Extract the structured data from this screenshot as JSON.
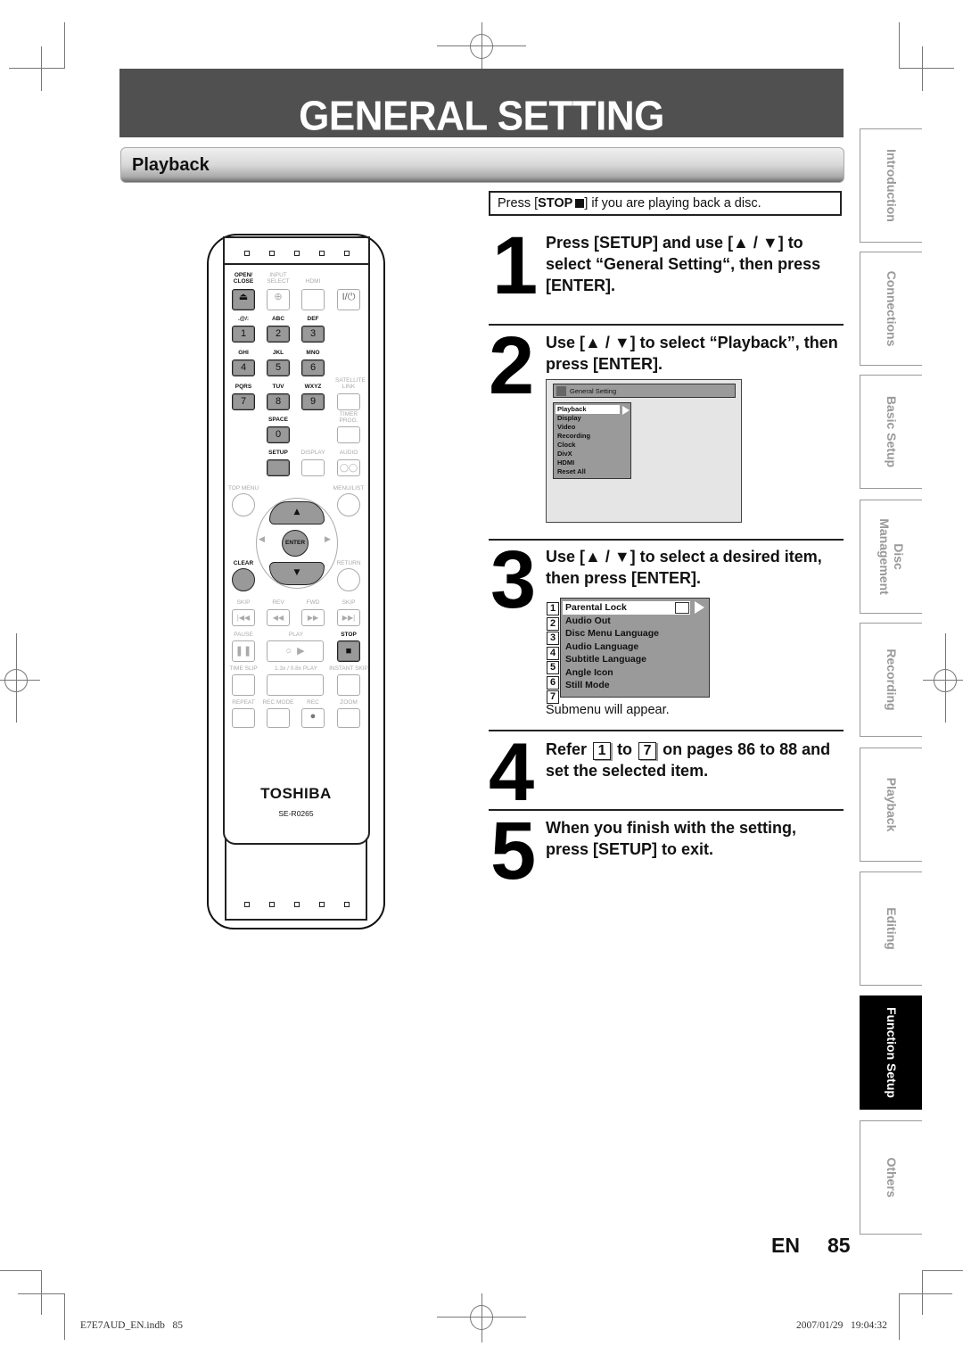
{
  "header": {
    "title": "GENERAL SETTING",
    "section": "Playback"
  },
  "note": {
    "prefix": "Press [",
    "button": "STOP",
    "suffix": "] if you are playing back a disc."
  },
  "steps": [
    {
      "number": "1",
      "lines": [
        "Press [SETUP] and use [▲ / ▼] to",
        "select “General Setting“, then press",
        "[ENTER]."
      ]
    },
    {
      "number": "2",
      "lines": [
        "Use [▲ / ▼] to select “Playback”, then",
        "press [ENTER]."
      ]
    },
    {
      "number": "3",
      "lines": [
        "Use [▲ / ▼] to select a desired item,",
        "then press [ENTER]."
      ],
      "caption": "Submenu will appear."
    },
    {
      "number": "4",
      "refer": "Refer",
      "from": "1",
      "to_word": "to",
      "to": "7",
      "rest": "on pages 86 to 88 and",
      "line2": "set the selected item."
    },
    {
      "number": "5",
      "lines": [
        "When you finish with the setting,",
        "press [SETUP] to exit."
      ]
    }
  ],
  "screen_general": {
    "title": "General Setting",
    "icon": "wrench-icon",
    "items": [
      "Playback",
      "Display",
      "Video",
      "Recording",
      "Clock",
      "DivX",
      "HDMI",
      "Reset All"
    ],
    "selected": "Playback"
  },
  "screen_playback": {
    "items": [
      {
        "num": "1",
        "label": "Parental Lock"
      },
      {
        "num": "2",
        "label": "Audio Out"
      },
      {
        "num": "3",
        "label": "Disc Menu Language"
      },
      {
        "num": "4",
        "label": "Audio Language"
      },
      {
        "num": "5",
        "label": "Subtitle Language"
      },
      {
        "num": "6",
        "label": "Angle Icon"
      },
      {
        "num": "7",
        "label": "Still Mode"
      }
    ],
    "selected": "Parental Lock",
    "selected_icon": "lock-icon"
  },
  "side_tabs": [
    {
      "label": "Introduction",
      "active": false
    },
    {
      "label": "Connections",
      "active": false
    },
    {
      "label": "Basic Setup",
      "active": false
    },
    {
      "label": "Disc Management",
      "line1": "Disc",
      "line2": "Management",
      "active": false
    },
    {
      "label": "Recording",
      "active": false
    },
    {
      "label": "Playback",
      "active": false
    },
    {
      "label": "Editing",
      "active": false
    },
    {
      "label": "Function Setup",
      "active": true
    },
    {
      "label": "Others",
      "active": false
    }
  ],
  "page": {
    "lang": "EN",
    "number": "85"
  },
  "footer": {
    "file": "E7E7AUD_EN.indb   85",
    "timestamp": "2007/01/29   19:04:32"
  },
  "remote": {
    "brand": "TOSHIBA",
    "model": "SE-R0265",
    "labels": {
      "open_close": "OPEN/ CLOSE",
      "input_select": "INPUT SELECT",
      "hdmi": "HDMI",
      "k1": ".@/:",
      "k2": "ABC",
      "k3": "DEF",
      "k4": "GHI",
      "k5": "JKL",
      "k6": "MNO",
      "k7": "PQRS",
      "k8": "TUV",
      "k9": "WXYZ",
      "satellite": "SATELLITE LINK",
      "space": "SPACE",
      "timer": "TIMER PROG.",
      "setup": "SETUP",
      "display": "DISPLAY",
      "audio": "AUDIO",
      "top_menu": "TOP MENU",
      "menu_list": "MENU/LIST",
      "enter": "ENTER",
      "clear": "CLEAR",
      "return": "RETURN",
      "skip_back": "SKIP",
      "rev": "REV",
      "fwd": "FWD",
      "skip_fwd": "SKIP",
      "pause": "PAUSE",
      "play": "PLAY",
      "stop": "STOP",
      "time_slip": "TIME SLIP",
      "play_speed": "1.3x / 0.8x PLAY",
      "instant_skip": "INSTANT SKIP",
      "repeat": "REPEAT",
      "rec_mode": "REC MODE",
      "rec": "REC",
      "zoom": "ZOOM"
    },
    "digits": [
      "1",
      "2",
      "3",
      "4",
      "5",
      "6",
      "7",
      "8",
      "9",
      "0"
    ]
  }
}
